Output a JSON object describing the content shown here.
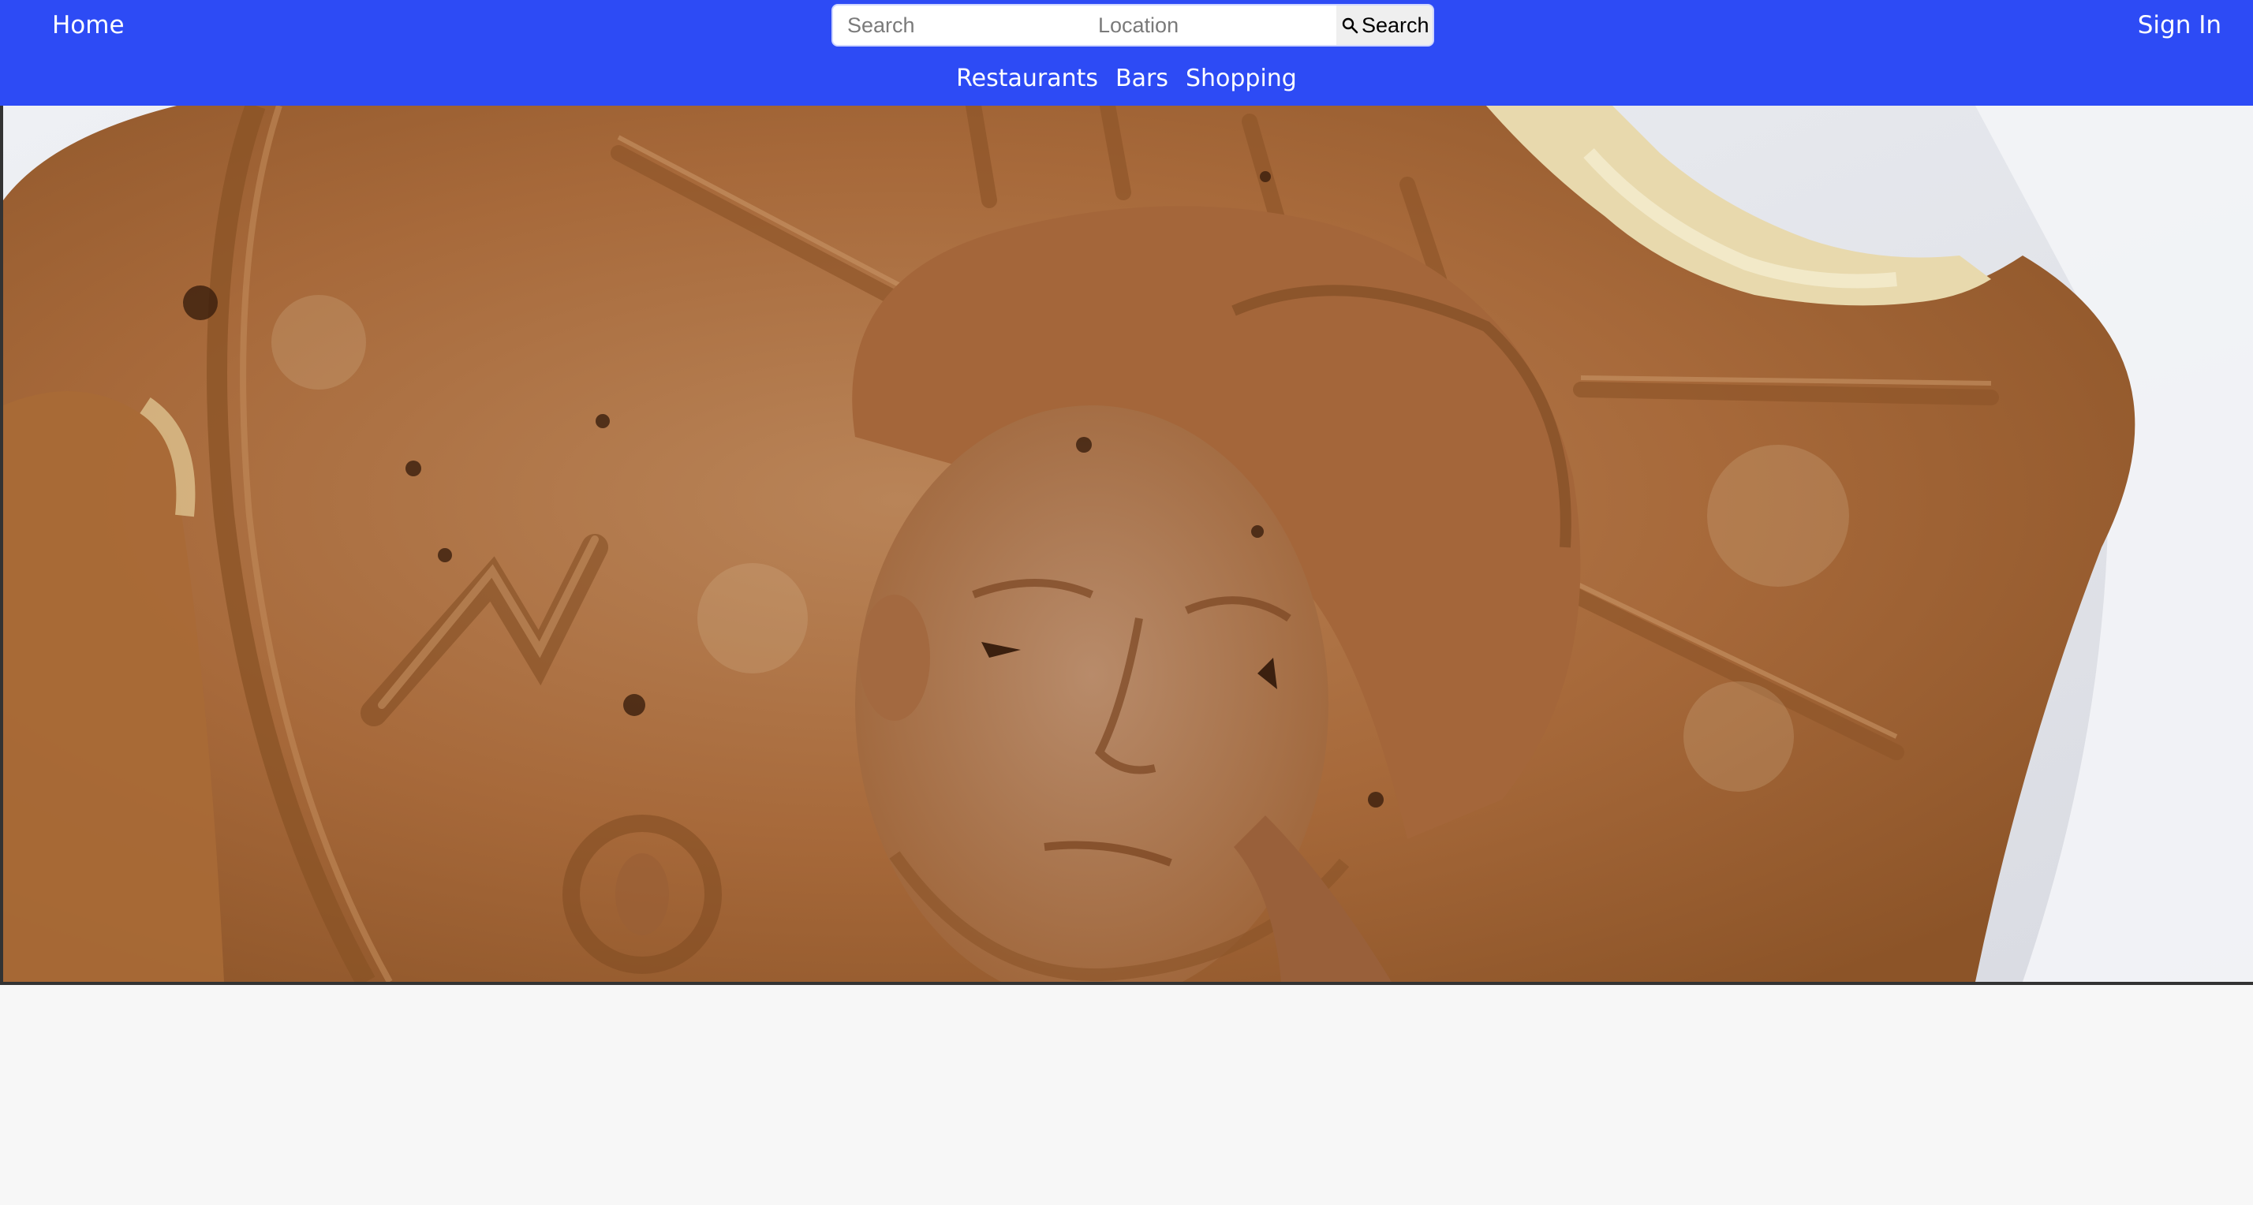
{
  "header": {
    "home_label": "Home",
    "signin_label": "Sign In",
    "search": {
      "query_placeholder": "Search",
      "query_value": "",
      "location_placeholder": "Location",
      "location_value": "",
      "button_label": "Search",
      "button_icon": "search-icon"
    },
    "categories": [
      {
        "label": "Restaurants"
      },
      {
        "label": "Bars"
      },
      {
        "label": "Shopping"
      }
    ]
  },
  "hero": {
    "image_alt": "",
    "subject": "coin-shaped waffle cake with Statue of Liberty face"
  },
  "colors": {
    "header_bg": "#2d4bf5",
    "page_bg": "#f7f7f7",
    "cake_brown": "#a86a3a"
  }
}
